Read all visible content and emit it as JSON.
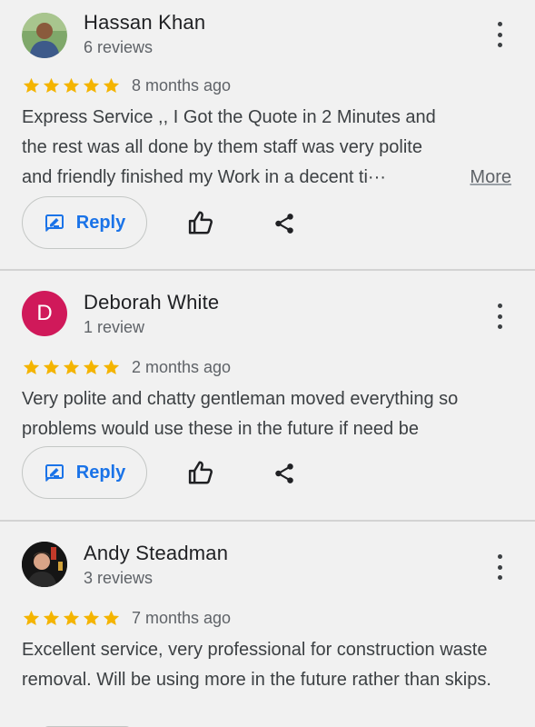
{
  "colors": {
    "star": "#f4b400",
    "accent": "#1a73e8",
    "avatar_deborah": "#d0195a"
  },
  "reviews": [
    {
      "name": "Hassan Khan",
      "count": "6 reviews",
      "rating": 5,
      "time": "8 months ago",
      "text": "Express Service ,, I Got the Quote in 2 Minutes and the rest was all done by them staff was very polite and friendly finished my Work in a decent ti···",
      "more": "More",
      "reply": "Reply",
      "avatar": "photo-avatar"
    },
    {
      "name": "Deborah White",
      "count": "1 review",
      "rating": 5,
      "time": "2 months ago",
      "text": "Very polite and chatty gentleman moved everything so problems would use these in the future if need be",
      "reply": "Reply",
      "avatar_letter": "D"
    },
    {
      "name": "Andy Steadman",
      "count": "3 reviews",
      "rating": 5,
      "time": "7 months ago",
      "text": "Excellent service, very professional for construction waste removal. Will be using more in the future rather than skips.",
      "avatar": "photo-avatar"
    }
  ],
  "icons": {
    "overflow": "more-vert-icon",
    "reply": "reply-edit-icon",
    "like": "thumb-up-icon",
    "share": "share-icon",
    "star": "star-icon"
  }
}
